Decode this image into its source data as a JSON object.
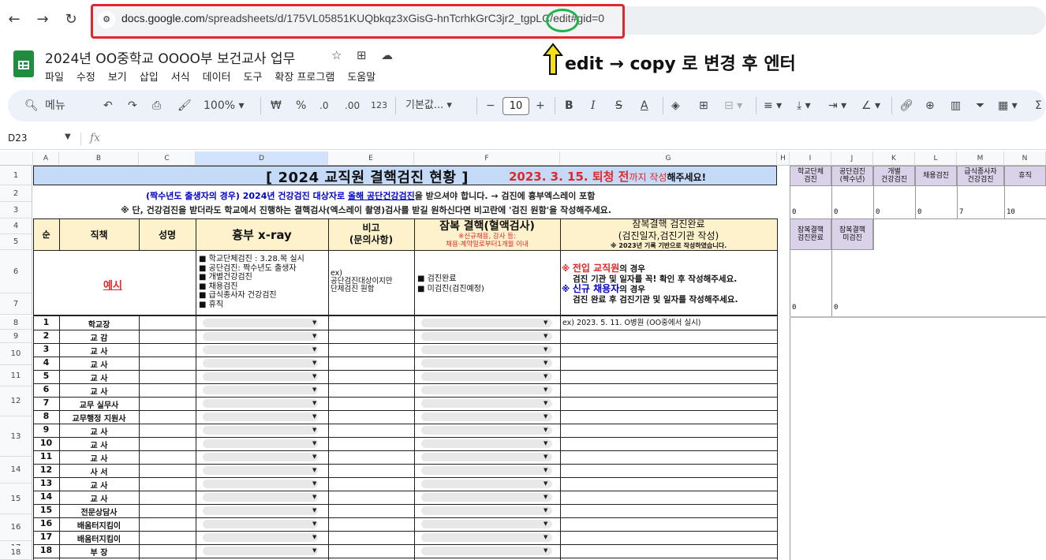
{
  "browser": {
    "url_domain": "docs.google.com",
    "url_path": "/spreadsheets/d/175VL05851KUQbkqz3xGisG-hnTcrhkGrC3jr2_tgpLC/edit#gid=0",
    "back_icon": "arrow-left-icon",
    "forward_icon": "arrow-right-icon",
    "reload_icon": "reload-icon"
  },
  "annotation": {
    "text": "edit → copy 로 변경 후 엔터",
    "arrow_color": "#f5e11a",
    "circle_color": "#22b14c",
    "box_color": "#e3262a"
  },
  "doc": {
    "title": "2024년 OO중학교 OOOO부 보건교사 업무",
    "menu": [
      "파일",
      "수정",
      "보기",
      "삽입",
      "서식",
      "데이터",
      "도구",
      "확장 프로그램",
      "도움말"
    ]
  },
  "toolbar": {
    "search_label": "메뉴",
    "zoom": "100%",
    "currency": "₩",
    "percent": "%",
    "dec_decrease": ".0",
    "dec_increase": ".00",
    "number_format": "123",
    "font_family": "기본값...",
    "font_size": "10",
    "bold": "B",
    "italic": "I",
    "strike": "S",
    "text_color": "A",
    "sigma": "Σ"
  },
  "formula": {
    "cell_ref": "D23",
    "fx": "fx"
  },
  "columns": [
    "A",
    "B",
    "C",
    "D",
    "E",
    "F",
    "G",
    "H",
    "I",
    "J",
    "K",
    "L",
    "M",
    "N"
  ],
  "rows_visible": [
    "1",
    "2",
    "3",
    "4",
    "5",
    "6",
    "7",
    "8",
    "9",
    "10",
    "11",
    "12",
    "13",
    "14",
    "15",
    "16",
    "17",
    "18"
  ],
  "sheet": {
    "title_main": "[ 2024 교직원 결핵검진 현황 ]",
    "title_date": "2023. 3. 15. 퇴청 전",
    "title_tail": "까지 작성",
    "title_end": "해주세요!",
    "notice1_a": "(짝수년도 출생자의 경우) 2024년 건강검진 대상자로 ",
    "notice1_b": "올해 공단건강검진",
    "notice1_c": "을 받으셔야 합니다. → 검진에 흉부엑스레이 포함",
    "notice2": "※ 단, 건강검진을 받더라도 학교에서 진행하는 결핵검사(엑스레이 촬영)검사를 받길 원하신다면 비고란에 '검진 원함'을 작성해주세요.",
    "headers": {
      "no": "순",
      "job": "직책",
      "name": "성명",
      "xray": "흉부 x-ray",
      "note1": "비고",
      "note2": "(문의사항)",
      "latent": "잠복 결핵(혈액검사)",
      "latent_sub1": "※신규채용, 강사 등:",
      "latent_sub2": "채용·계약일로부터1개월 이내",
      "done1": "잠복결핵 검진완료",
      "done2": "(검진일자,검진기관 작성)",
      "done_sub": "※ 2023년 기록 기반으로 작성하였습니다."
    },
    "example": {
      "label": "예시",
      "xray_options": [
        "■ 학교단체검진 : 3.28.목 실시",
        "■ 공단검진: 짝수년도 출생자",
        "■ 개별건강검진",
        "■ 채용검진",
        "■ 급식종사자 건강검진",
        "■ 휴직"
      ],
      "note": [
        "ex)",
        "공단검진대상이지만",
        "단체검진 원함"
      ],
      "latent_options": [
        "■ 검진완료",
        "■ 미검진(검진예정)"
      ],
      "done_mark1": "※ ",
      "done_red1": "전입 교직원",
      "done_txt1": "의 경우",
      "done_line2": "검진 기관 및 일자를 꼭! 확인 후 작성해주세요.",
      "done_mark2": "※ ",
      "done_blue2": "신규 채용자",
      "done_txt2": "의 경우",
      "done_line4": "검진 완료 후 검진기관 및 일자를 작성해주세요."
    },
    "rows": [
      {
        "no": "1",
        "job": "학교장",
        "done": "ex) 2023. 5. 11. O병원 (OO중에서 실시)"
      },
      {
        "no": "2",
        "job": "교 감",
        "done": ""
      },
      {
        "no": "3",
        "job": "교 사",
        "done": ""
      },
      {
        "no": "4",
        "job": "교 사",
        "done": ""
      },
      {
        "no": "5",
        "job": "교 사",
        "done": ""
      },
      {
        "no": "6",
        "job": "교 사",
        "done": ""
      },
      {
        "no": "7",
        "job": "교무 실무사",
        "done": ""
      },
      {
        "no": "8",
        "job": "교무행정 지원사",
        "done": ""
      },
      {
        "no": "9",
        "job": "교 사",
        "done": ""
      },
      {
        "no": "10",
        "job": "교 사",
        "done": ""
      },
      {
        "no": "11",
        "job": "교 사",
        "done": ""
      },
      {
        "no": "12",
        "job": "사 서",
        "done": ""
      },
      {
        "no": "13",
        "job": "교 사",
        "done": ""
      },
      {
        "no": "14",
        "job": "교 사",
        "done": ""
      },
      {
        "no": "15",
        "job": "전문상담사",
        "done": ""
      },
      {
        "no": "16",
        "job": "배움터지킴이",
        "done": ""
      },
      {
        "no": "17",
        "job": "배움터지킴이",
        "done": ""
      },
      {
        "no": "18",
        "job": "부 장",
        "done": ""
      }
    ]
  },
  "summary": {
    "headers": [
      "학교단체\n검진",
      "공단검진\n(짝수년)",
      "개별\n건강검진",
      "채용검진",
      "급식종사자\n건강검진",
      "휴직"
    ],
    "values": [
      "0",
      "0",
      "0",
      "0",
      "7",
      "10"
    ],
    "headers2": [
      "잠복결핵\n검진완료",
      "잠복결핵\n미검진"
    ],
    "values2": [
      "0",
      "0"
    ]
  }
}
